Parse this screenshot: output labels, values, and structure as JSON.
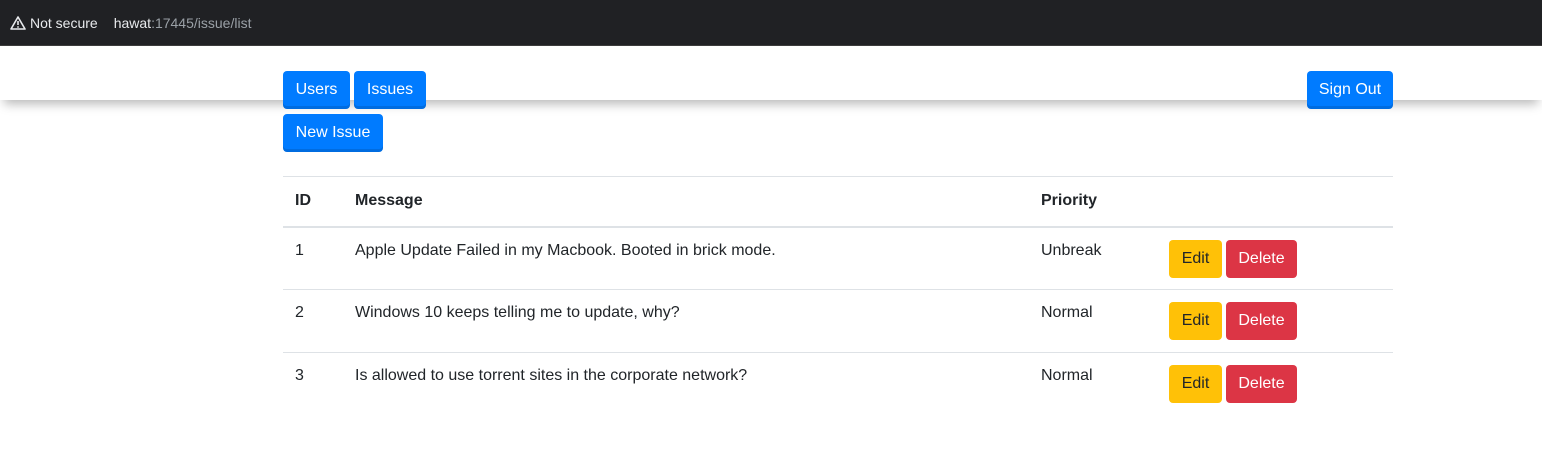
{
  "browser": {
    "security_label": "Not secure",
    "url_host": "hawat",
    "url_rest": ":17445/issue/list"
  },
  "nav": {
    "users_label": "Users",
    "issues_label": "Issues",
    "signout_label": "Sign Out"
  },
  "toolbar": {
    "new_issue_label": "New Issue"
  },
  "table": {
    "headers": {
      "id": "ID",
      "message": "Message",
      "priority": "Priority",
      "actions": ""
    },
    "rows": [
      {
        "id": "1",
        "message": "Apple Update Failed in my Macbook. Booted in brick mode.",
        "priority": "Unbreak",
        "edit_label": "Edit",
        "delete_label": "Delete"
      },
      {
        "id": "2",
        "message": "Windows 10 keeps telling me to update, why?",
        "priority": "Normal",
        "edit_label": "Edit",
        "delete_label": "Delete"
      },
      {
        "id": "3",
        "message": "Is allowed to use torrent sites in the corporate network?",
        "priority": "Normal",
        "edit_label": "Edit",
        "delete_label": "Delete"
      }
    ]
  },
  "colors": {
    "primary": "#007bff",
    "warning": "#ffc107",
    "danger": "#dc3545",
    "browser_bar": "#202124"
  }
}
